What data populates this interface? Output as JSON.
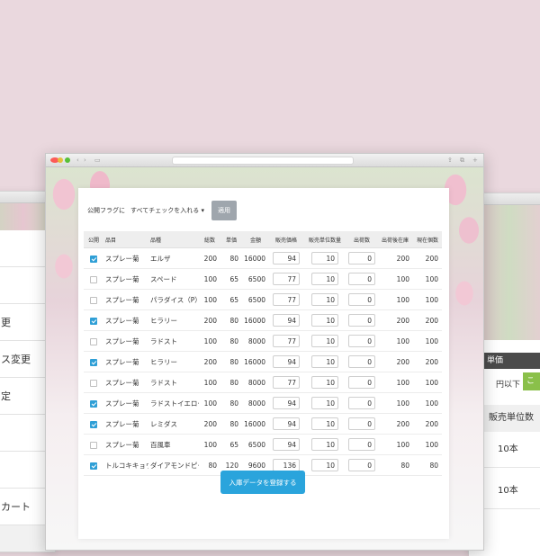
{
  "left_window": {
    "menu": [
      "",
      "",
      "更",
      "ス変更",
      "定",
      "",
      "",
      "カート"
    ]
  },
  "right_window": {
    "tanka_header": "単価",
    "ika_label": "円以下",
    "green_btn": "こ",
    "column_header": "販売単位数",
    "cells": [
      "10本",
      "10本"
    ]
  },
  "filter": {
    "label": "公開フラグに",
    "select": "すべてチェックを入れる ▾",
    "apply": "適用"
  },
  "table": {
    "headers": [
      "公開",
      "品目",
      "品種",
      "総数",
      "単価",
      "金額",
      "販売価格",
      "販売単位数量",
      "出荷数",
      "出荷後在庫",
      "現在個数"
    ],
    "rows": [
      {
        "checked": true,
        "item": "スプレー菊",
        "variety": "エルザ",
        "total": "200",
        "unit_price": "80",
        "amount": "16000",
        "sale_price": "94",
        "sale_unit": "10",
        "shipped": "0",
        "after_stock": "200",
        "current": "200"
      },
      {
        "checked": false,
        "item": "スプレー菊",
        "variety": "スペード",
        "total": "100",
        "unit_price": "65",
        "amount": "6500",
        "sale_price": "77",
        "sale_unit": "10",
        "shipped": "0",
        "after_stock": "100",
        "current": "100"
      },
      {
        "checked": false,
        "item": "スプレー菊",
        "variety": "パラダイス（P）",
        "total": "100",
        "unit_price": "65",
        "amount": "6500",
        "sale_price": "77",
        "sale_unit": "10",
        "shipped": "0",
        "after_stock": "100",
        "current": "100"
      },
      {
        "checked": true,
        "item": "スプレー菊",
        "variety": "ヒラリー",
        "total": "200",
        "unit_price": "80",
        "amount": "16000",
        "sale_price": "94",
        "sale_unit": "10",
        "shipped": "0",
        "after_stock": "200",
        "current": "200"
      },
      {
        "checked": false,
        "item": "スプレー菊",
        "variety": "ラドスト",
        "total": "100",
        "unit_price": "80",
        "amount": "8000",
        "sale_price": "77",
        "sale_unit": "10",
        "shipped": "0",
        "after_stock": "100",
        "current": "100"
      },
      {
        "checked": true,
        "item": "スプレー菊",
        "variety": "ヒラリー",
        "total": "200",
        "unit_price": "80",
        "amount": "16000",
        "sale_price": "94",
        "sale_unit": "10",
        "shipped": "0",
        "after_stock": "200",
        "current": "200"
      },
      {
        "checked": false,
        "item": "スプレー菊",
        "variety": "ラドスト",
        "total": "100",
        "unit_price": "80",
        "amount": "8000",
        "sale_price": "77",
        "sale_unit": "10",
        "shipped": "0",
        "after_stock": "100",
        "current": "100"
      },
      {
        "checked": true,
        "item": "スプレー菊",
        "variety": "ラドストイエロー",
        "total": "100",
        "unit_price": "80",
        "amount": "8000",
        "sale_price": "94",
        "sale_unit": "10",
        "shipped": "0",
        "after_stock": "100",
        "current": "100"
      },
      {
        "checked": true,
        "item": "スプレー菊",
        "variety": "レミダス",
        "total": "200",
        "unit_price": "80",
        "amount": "16000",
        "sale_price": "94",
        "sale_unit": "10",
        "shipped": "0",
        "after_stock": "200",
        "current": "200"
      },
      {
        "checked": false,
        "item": "スプレー菊",
        "variety": "百風車",
        "total": "100",
        "unit_price": "65",
        "amount": "6500",
        "sale_price": "94",
        "sale_unit": "10",
        "shipped": "0",
        "after_stock": "100",
        "current": "100"
      },
      {
        "checked": true,
        "item": "トルコキキョウ",
        "variety": "ダイアモンドピーチ",
        "total": "80",
        "unit_price": "120",
        "amount": "9600",
        "sale_price": "136",
        "sale_unit": "10",
        "shipped": "0",
        "after_stock": "80",
        "current": "80"
      }
    ]
  },
  "submit_label": "入庫データを登録する",
  "colors": {
    "background": "#ead8de",
    "accent": "#2aa4dc",
    "apply_button": "#9fa6ad"
  }
}
